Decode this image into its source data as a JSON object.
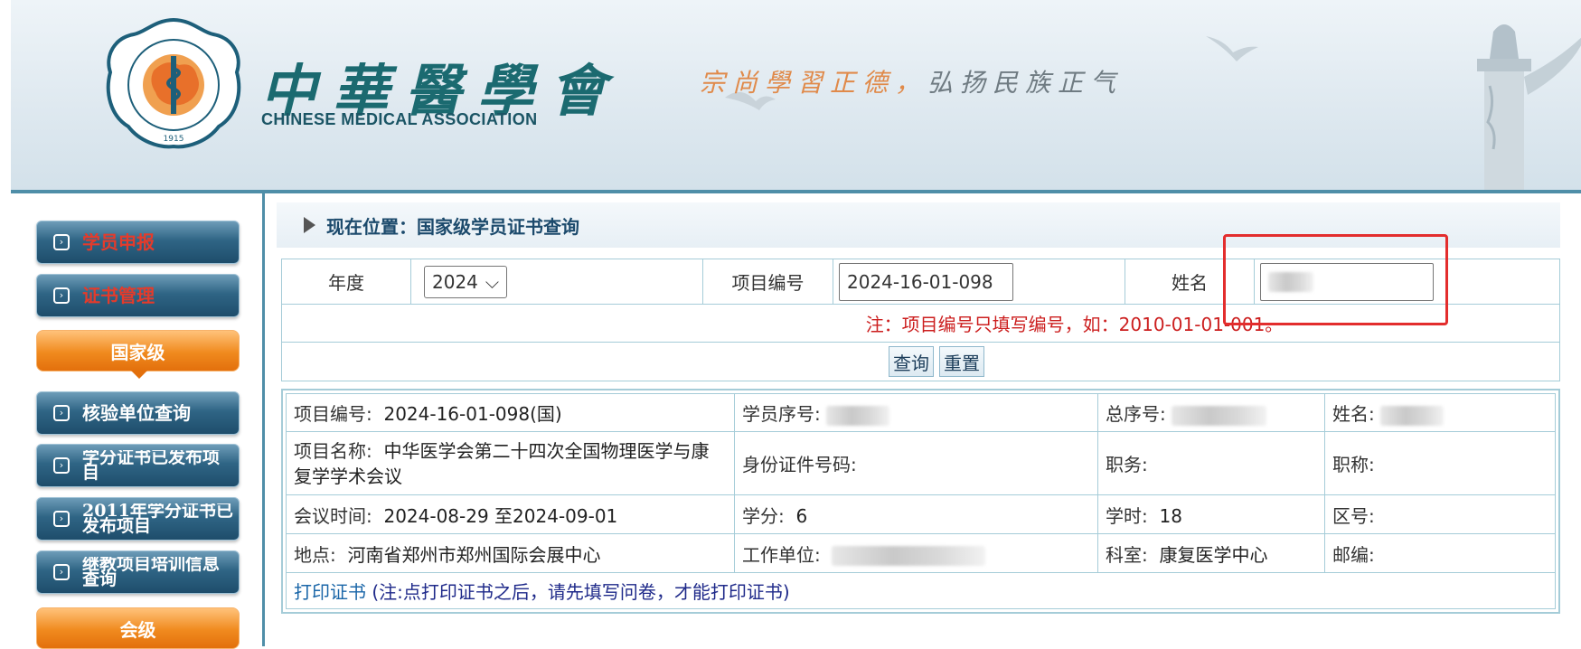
{
  "header": {
    "org_name_cn": "中華醫學會",
    "org_name_en": "CHINESE MEDICAL ASSOCIATION",
    "slogan_part1": "宗尚學習正德，",
    "slogan_part2": "弘扬民族正气",
    "seal_text": "中华医学会",
    "seal_text_en": "CHINESE MEDICAL ASSOCIATION",
    "seal_year": "1915"
  },
  "sidebar": {
    "items": [
      {
        "label": "学员申报"
      },
      {
        "label": "证书管理"
      },
      {
        "section": "国家级"
      },
      {
        "label": "核验单位查询"
      },
      {
        "label": "学分证书已发布项目"
      },
      {
        "label": "2011年学分证书已发布项目"
      },
      {
        "label": "继教项目培训信息查询"
      },
      {
        "section": "会级"
      }
    ]
  },
  "breadcrumb": {
    "text": "现在位置：国家级学员证书查询"
  },
  "search": {
    "year_label": "年度",
    "year_value": "2024",
    "project_no_label": "项目编号",
    "project_no_value": "2024-16-01-098",
    "name_label": "姓名",
    "note": "注：项目编号只填写编号，如：2010-01-01-001。",
    "query_button": "查询",
    "reset_button": "重置"
  },
  "result": {
    "row1": {
      "project_no_label": "项目编号:",
      "project_no_value": "2024-16-01-098(国)",
      "student_no_label": "学员序号:",
      "total_no_label": "总序号:",
      "name_label": "姓名:"
    },
    "row2": {
      "project_name_label": "项目名称:",
      "project_name_value": "中华医学会第二十四次全国物理医学与康复学学术会议",
      "id_label": "身份证件号码:",
      "job_label": "职务:",
      "title_label": "职称:"
    },
    "row3": {
      "time_label": "会议时间:",
      "time_value": "2024-08-29 至2024-09-01",
      "credit_label": "学分:",
      "credit_value": "6",
      "hours_label": "学时:",
      "hours_value": "18",
      "area_label": "区号:"
    },
    "row4": {
      "place_label": "地点:",
      "place_value": "河南省郑州市郑州国际会展中心",
      "unit_label": "工作单位:",
      "dept_label": "科室:",
      "dept_value": "康复医学中心",
      "zip_label": "邮编:"
    },
    "print_link": "打印证书",
    "print_note": "(注:点打印证书之后，请先填写问卷，才能打印证书)"
  },
  "colors": {
    "nav_blue": "#2f6585",
    "section_orange": "#f08a1e",
    "sidebar_red_text": "#e43b2b",
    "note_red": "#cc1f1f",
    "highlight": "#e32d2d"
  }
}
